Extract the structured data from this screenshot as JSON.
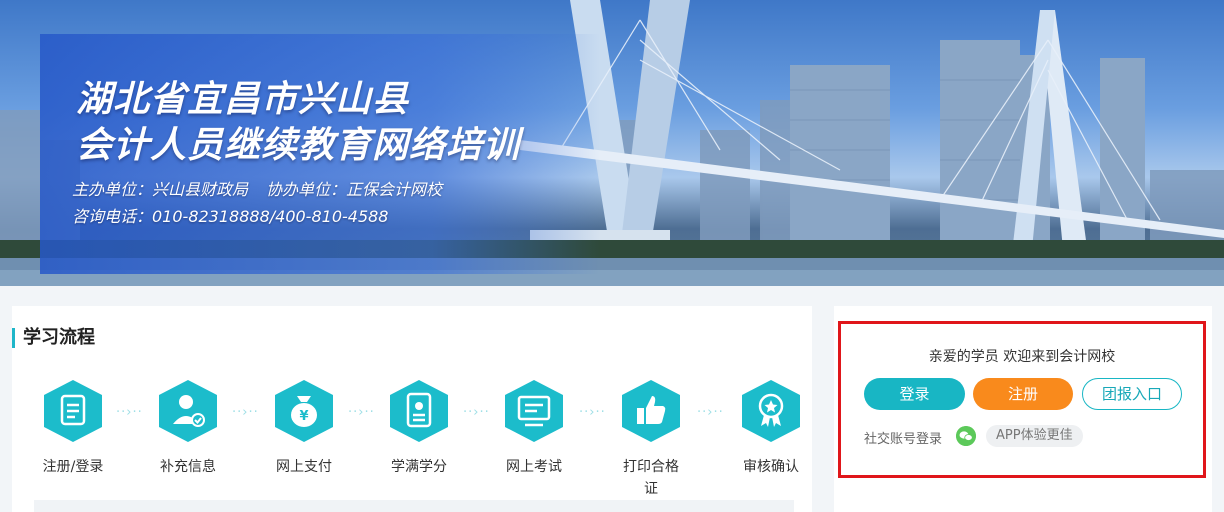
{
  "banner": {
    "title_line1": "湖北省宜昌市兴山县",
    "title_line2": "会计人员继续教育网络培训",
    "host_label": "主办单位：兴山县财政局",
    "cohost_label": "协办单位：正保会计网校",
    "phone_label": "咨询电话：010-82318888/400-810-4588"
  },
  "process": {
    "title": "学习流程",
    "accent_color": "#1eb6c9",
    "steps": [
      {
        "label": "注册/登录",
        "icon": "clipboard-icon"
      },
      {
        "label": "补充信息",
        "icon": "user-check-icon"
      },
      {
        "label": "网上支付",
        "icon": "money-bag-icon"
      },
      {
        "label": "学满学分",
        "icon": "certificate-icon"
      },
      {
        "label": "网上考试",
        "icon": "monitor-icon"
      },
      {
        "label": "打印合格证",
        "label_line1": "打印合格",
        "label_line2": "证",
        "icon": "thumbs-up-icon"
      },
      {
        "label": "审核确认",
        "icon": "award-badge-icon"
      }
    ],
    "connector": "··›··"
  },
  "login": {
    "welcome": "亲爱的学员 欢迎来到会计网校",
    "login_button": "登录",
    "register_button": "注册",
    "group_button": "团报入口",
    "social_label": "社交账号登录",
    "social_icon": "wechat-icon",
    "app_badge": "APP体验更佳",
    "colors": {
      "login": "#18b6c4",
      "register": "#f98a1c",
      "highlight": "#e0161a"
    }
  }
}
